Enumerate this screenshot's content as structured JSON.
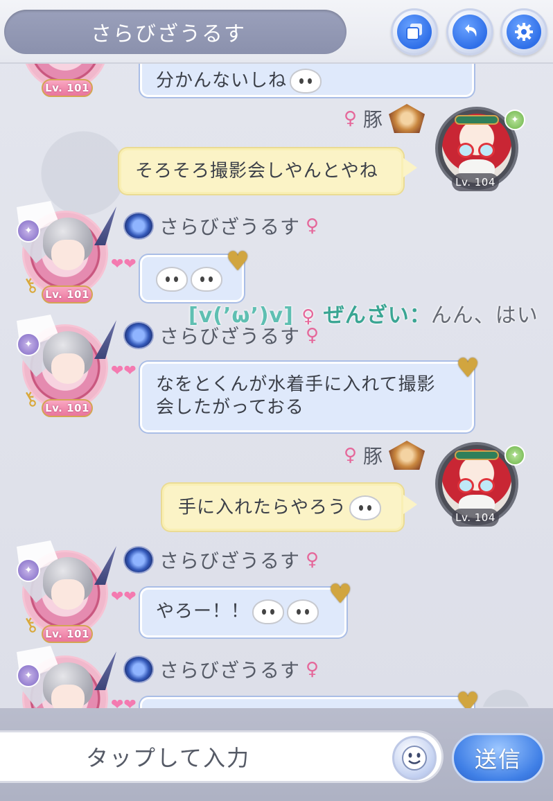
{
  "header": {
    "title": "さらびざうるす"
  },
  "chat": {
    "partial_top_text": "分かんないしね",
    "messages": [
      {
        "sender": "豚",
        "level": "Lv. 104",
        "text": "そろそろ撮影会しやんとやね"
      },
      {
        "sender": "さらびざうるす",
        "level": "Lv. 101",
        "text": ""
      },
      {
        "sender": "さらびざうるす",
        "level": "Lv. 101",
        "text_line1": "なをとくんが水着手に入れて撮影",
        "text_line2": "会したがっておる"
      },
      {
        "sender": "豚",
        "level": "Lv. 104",
        "text": "手に入れたらやろう"
      },
      {
        "sender": "さらびざうるす",
        "level": "Lv. 101",
        "text": "やろー！！"
      },
      {
        "sender": "さらびざうるす",
        "level": "",
        "text": ""
      }
    ],
    "overlay": {
      "prefix": "[v(’ω’)v]",
      "sender": "ぜんざい：",
      "text": "んん、はい"
    },
    "top_partial_level": "Lv. 101"
  },
  "input": {
    "placeholder": "タップして入力",
    "send_label": "送信"
  },
  "colors": {
    "accent_blue": "#3f7fe6",
    "own_bubble": "#fbf3c6",
    "other_bubble": "#dfe9fb",
    "title_pill": "#9aa0bb"
  },
  "icons": [
    "window-icon",
    "back-icon",
    "gear-icon",
    "emoji-icon",
    "heart-icon",
    "gold-heart-icon",
    "female-icon"
  ]
}
